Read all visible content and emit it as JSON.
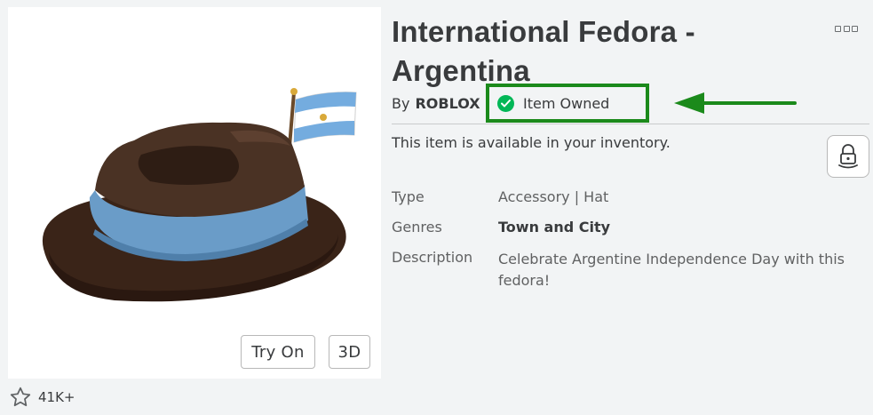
{
  "item": {
    "title": "International Fedora - Argentina",
    "by_label": "By",
    "creator": "ROBLOX",
    "owned_label": "Item Owned",
    "availability": "This item is available in your inventory."
  },
  "thumbnail": {
    "try_on_label": "Try On",
    "view_3d_label": "3D"
  },
  "favorites": {
    "count": "41K+"
  },
  "details": {
    "type_label": "Type",
    "type_value": "Accessory | Hat",
    "genres_label": "Genres",
    "genres_value": "Town and City",
    "description_label": "Description",
    "description_value": "Celebrate Argentine Independence Day with this fedora!"
  },
  "colors": {
    "owned_check": "#02b757",
    "annotation_green": "#1b8a1b",
    "hat_brown": "#3f2a1e",
    "band_blue": "#6a9cc8"
  },
  "icons": {
    "more": "more-options-icon",
    "trade": "avatar-lock-icon",
    "favorite": "star-icon",
    "owned": "checkmark-icon"
  }
}
